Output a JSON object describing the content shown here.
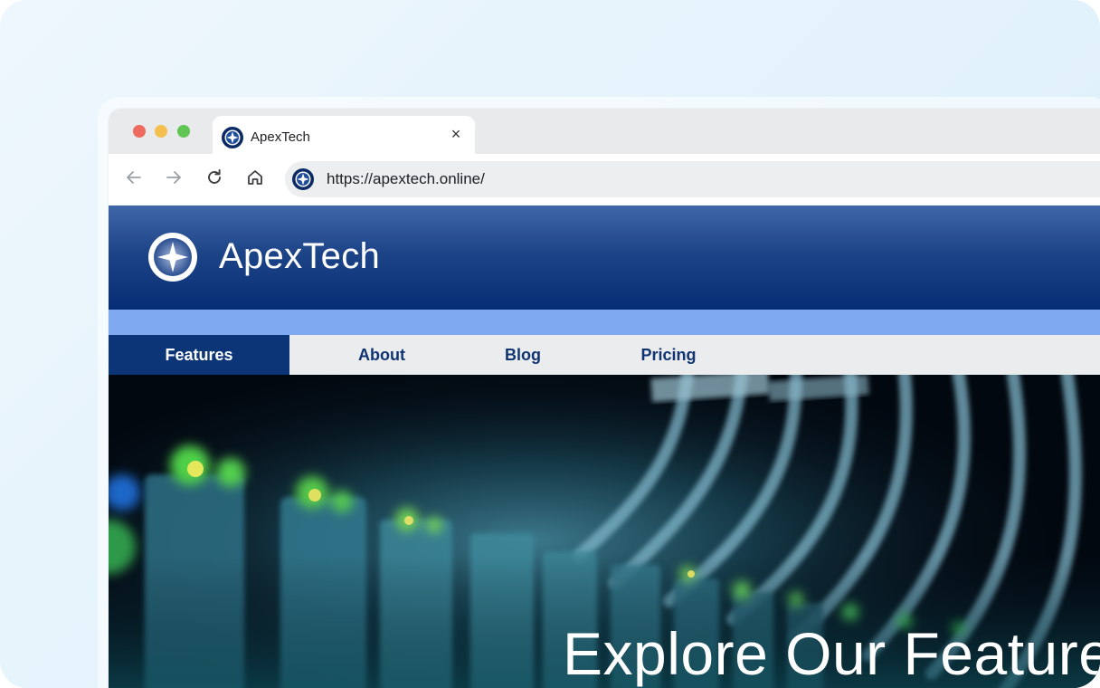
{
  "browser": {
    "tab": {
      "title": "ApexTech",
      "close_glyph": "×"
    },
    "address_bar": {
      "url": "https://apextech.online/"
    },
    "icons": [
      "back-icon",
      "forward-icon",
      "reload-icon",
      "home-icon",
      "site-favicon"
    ]
  },
  "site": {
    "brand": "ApexTech",
    "nav": [
      {
        "label": "Features",
        "active": true
      },
      {
        "label": "About",
        "active": false
      },
      {
        "label": "Blog",
        "active": false
      },
      {
        "label": "Pricing",
        "active": false
      }
    ],
    "hero": {
      "title": "Explore Our Features"
    }
  },
  "colors": {
    "header_top": "#3f67a8",
    "header_bottom": "#062c73",
    "accent_stripe": "#80aaf0",
    "nav_active": "#0c3578",
    "nav_text": "#0f3470"
  }
}
